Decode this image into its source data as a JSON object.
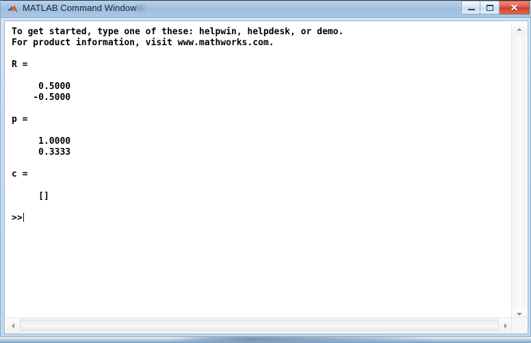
{
  "window": {
    "title": "MATLAB Command Window",
    "icon": "matlab-membrane-icon",
    "controls": {
      "minimize_label": "–",
      "maximize_label": "□",
      "close_label": "✕"
    },
    "frame_color": "#c2d8ec",
    "titlebar_color": "#9dbedd",
    "close_button_color": "#cf3d27"
  },
  "console": {
    "prompt": ">>",
    "lines": [
      "To get started, type one of these: helpwin, helpdesk, or demo.",
      "For product information, visit www.mathworks.com.",
      "",
      "R =",
      "",
      "     0.5000",
      "    -0.5000",
      "",
      "p =",
      "",
      "     1.0000",
      "     0.3333",
      "",
      "c =",
      "",
      "     []",
      ""
    ],
    "text_color": "#000000",
    "background_color": "#ffffff",
    "variables": [
      {
        "name": "R",
        "values": [
          "0.5000",
          "-0.5000"
        ]
      },
      {
        "name": "p",
        "values": [
          "1.0000",
          "0.3333"
        ]
      },
      {
        "name": "c",
        "values": [
          "[]"
        ]
      }
    ]
  },
  "scrollbars": {
    "vertical": {
      "up_arrow": "scroll-up-icon",
      "down_arrow": "scroll-down-icon"
    },
    "horizontal": {
      "left_arrow": "scroll-left-icon",
      "right_arrow": "scroll-right-icon"
    }
  }
}
